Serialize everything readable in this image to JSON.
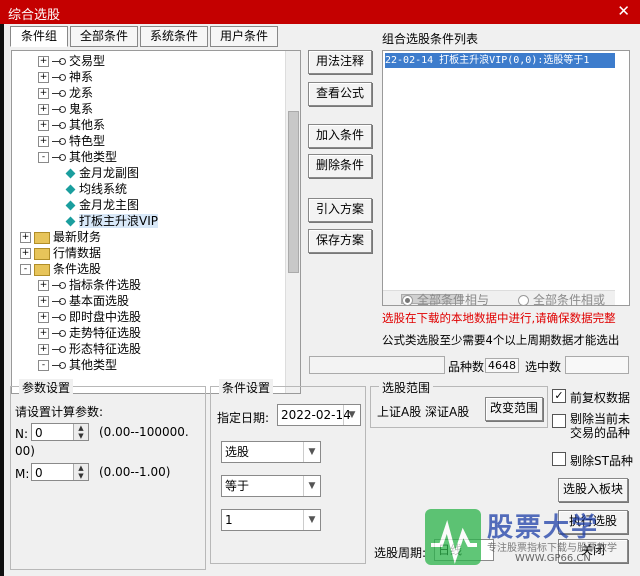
{
  "window": {
    "title": "综合选股",
    "close_glyph": "✕"
  },
  "tabs": [
    "条件组",
    "全部条件",
    "系统条件",
    "用户条件"
  ],
  "tree": [
    {
      "label": "交易型",
      "level": 1,
      "icon": "key",
      "expander": "+"
    },
    {
      "label": "神系",
      "level": 1,
      "icon": "key",
      "expander": "+"
    },
    {
      "label": "龙系",
      "level": 1,
      "icon": "key",
      "expander": "+"
    },
    {
      "label": "鬼系",
      "level": 1,
      "icon": "key",
      "expander": "+"
    },
    {
      "label": "其他系",
      "level": 1,
      "icon": "key",
      "expander": "+"
    },
    {
      "label": "特色型",
      "level": 1,
      "icon": "key",
      "expander": "+"
    },
    {
      "label": "其他类型",
      "level": 1,
      "icon": "key",
      "expander": "-"
    },
    {
      "label": "金月龙副图",
      "level": 2,
      "icon": "diamond",
      "expander": ""
    },
    {
      "label": "均线系统",
      "level": 2,
      "icon": "diamond",
      "expander": ""
    },
    {
      "label": "金月龙主图",
      "level": 2,
      "icon": "diamond",
      "expander": ""
    },
    {
      "label": "打板主升浪VIP",
      "level": 2,
      "icon": "diamond",
      "expander": "",
      "selected": true
    },
    {
      "label": "最新财务",
      "level": 0,
      "icon": "folder",
      "expander": "+"
    },
    {
      "label": "行情数据",
      "level": 0,
      "icon": "folder",
      "expander": "+"
    },
    {
      "label": "条件选股",
      "level": 0,
      "icon": "folder",
      "expander": "-"
    },
    {
      "label": "指标条件选股",
      "level": 1,
      "icon": "key",
      "expander": "+"
    },
    {
      "label": "基本面选股",
      "level": 1,
      "icon": "key",
      "expander": "+"
    },
    {
      "label": "即时盘中选股",
      "level": 1,
      "icon": "key",
      "expander": "+"
    },
    {
      "label": "走势特征选股",
      "level": 1,
      "icon": "key",
      "expander": "+"
    },
    {
      "label": "形态特征选股",
      "level": 1,
      "icon": "key",
      "expander": "+"
    },
    {
      "label": "其他类型",
      "level": 1,
      "icon": "key",
      "expander": "-"
    }
  ],
  "buttons": {
    "usage": "用法注释",
    "view_formula": "查看公式",
    "add_condition": "加入条件",
    "delete_condition": "删除条件",
    "import_plan": "引入方案",
    "save_plan": "保存方案",
    "change_range": "改变范围",
    "select_to_block": "选股入板块",
    "execute": "执行选股",
    "close": "关闭"
  },
  "condition_list": {
    "title": "组合选股条件列表",
    "items": [
      "22-02-14 打板主升浪VIP(0,0):选股等于1"
    ]
  },
  "logic": {
    "and_label": "全部条件相与",
    "or_label": "全部条件相或"
  },
  "notes": {
    "red": "选股在下载的本地数据中进行,请确保数据完整",
    "black": "公式类选股至少需要4个以上周期数据才能选出"
  },
  "counts": {
    "variety_label": "品种数",
    "variety_value": "4648",
    "selected_label": "选中数",
    "selected_value": ""
  },
  "params": {
    "title": "参数设置",
    "prompt": "请设置计算参数:",
    "n_label": "N:",
    "n_value": "0",
    "n_range_a": "(0.00--100000.",
    "n_range_b": "00)",
    "m_label": "M:",
    "m_value": "0",
    "m_range": "(0.00--1.00)"
  },
  "condition_settings": {
    "title": "条件设置",
    "date_label": "指定日期:",
    "date_value": "2022-02-14",
    "select_type": "选股",
    "operator": "等于",
    "value": "1"
  },
  "range": {
    "title": "选股范围",
    "markets": "上证A股  深证A股"
  },
  "options": {
    "pre_adjust": "前复权数据",
    "exclude_suspended": "剔除当前未交易的品种",
    "exclude_st": "剔除ST品种"
  },
  "period": {
    "label": "选股周期:",
    "value": "日线"
  },
  "watermark": {
    "brand": "股票大学",
    "slogan": "专注股票指标下载与股票教学",
    "url": "WWW.GP66.CN"
  }
}
